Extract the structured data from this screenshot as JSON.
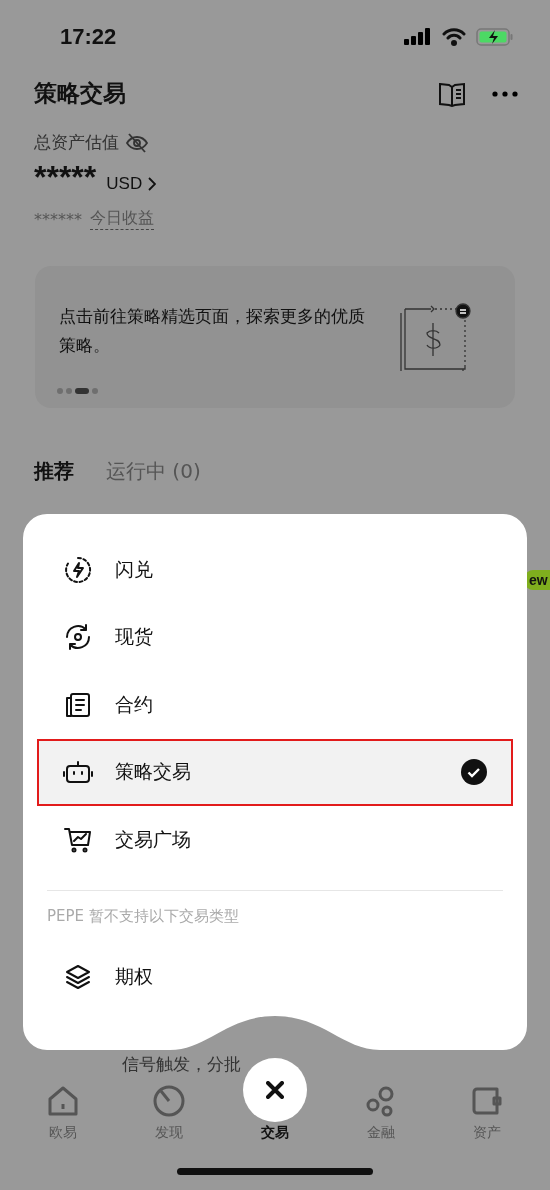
{
  "status_bar": {
    "time": "17:22"
  },
  "header": {
    "title": "策略交易"
  },
  "assets": {
    "label": "总资产估值",
    "value": "*****",
    "currency": "USD",
    "today_value": "******",
    "today_label": "今日收益"
  },
  "banner": {
    "text": "点击前往策略精选页面，探索更多的优质策略。",
    "pages": [
      {
        "selected": false
      },
      {
        "selected": false
      },
      {
        "selected": true
      },
      {
        "selected": false
      }
    ]
  },
  "tabs": [
    {
      "label": "推荐",
      "selected": true
    },
    {
      "label": "运行中 (0)",
      "selected": false
    }
  ],
  "badge": "ew",
  "list_snippet": "信号触发，分批",
  "menu": {
    "items": [
      {
        "kind": "flash",
        "label": "闪兑",
        "selected": false
      },
      {
        "kind": "spot",
        "label": "现货",
        "selected": false
      },
      {
        "kind": "contract",
        "label": "合约",
        "selected": false
      },
      {
        "kind": "bot",
        "label": "策略交易",
        "selected": true
      },
      {
        "kind": "market",
        "label": "交易广场",
        "selected": false
      }
    ],
    "note": "PEPE 暂不支持以下交易类型",
    "unsupported": [
      {
        "kind": "layers",
        "label": "期权",
        "selected": false
      }
    ]
  },
  "nav": [
    {
      "kind": "home",
      "label": "欧易",
      "selected": false
    },
    {
      "kind": "discover",
      "label": "发现",
      "selected": false
    },
    {
      "kind": "trade",
      "label": "交易",
      "selected": true
    },
    {
      "kind": "finance",
      "label": "金融",
      "selected": false
    },
    {
      "kind": "wallet",
      "label": "资产",
      "selected": false
    }
  ]
}
